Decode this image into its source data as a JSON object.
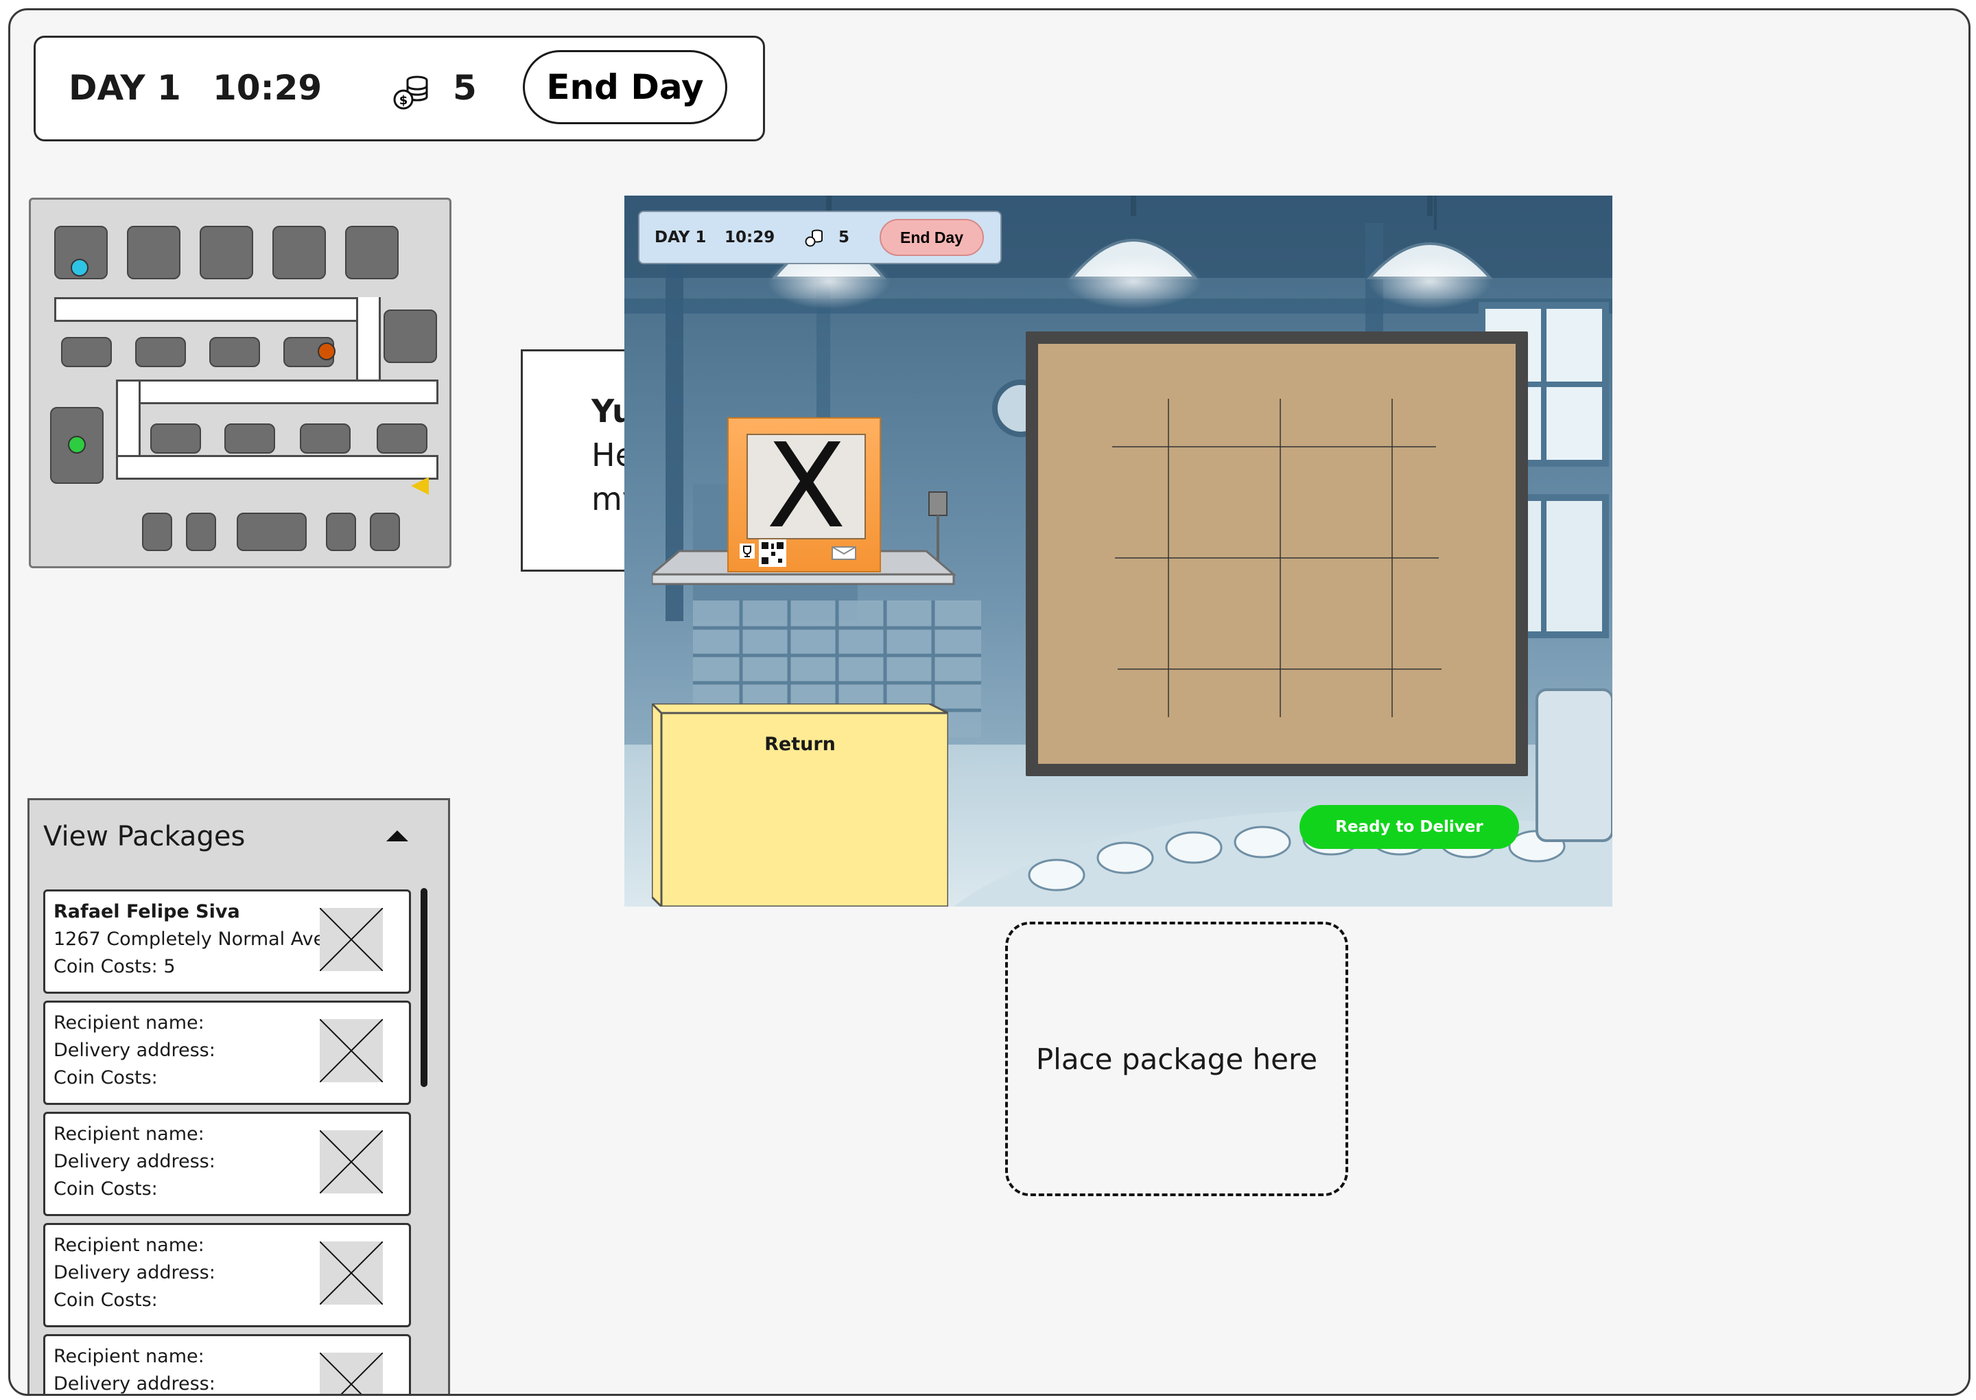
{
  "hud": {
    "day": "DAY 1",
    "time": "10:29",
    "coins": "5",
    "end_day": "End Day"
  },
  "scene_hud": {
    "day": "DAY 1",
    "time": "10:29",
    "coins": "5",
    "end_day": "End Day"
  },
  "dialogue": {
    "lines": [
      "Yu",
      "He",
      "my"
    ]
  },
  "packages": {
    "title": "View Packages",
    "cards": [
      {
        "name": "Rafael Felipe Siva",
        "address": "1267 Completely Normal Ave",
        "cost": "Coin Costs: 5"
      },
      {
        "name": "Recipient name:",
        "address": "Delivery address:",
        "cost": "Coin Costs:"
      },
      {
        "name": "Recipient name:",
        "address": "Delivery address:",
        "cost": "Coin Costs:"
      },
      {
        "name": "Recipient name:",
        "address": "Delivery address:",
        "cost": "Coin Costs:"
      },
      {
        "name": "Recipient name:",
        "address": "Delivery address:",
        "cost": ""
      }
    ]
  },
  "scene": {
    "package_mark": "X",
    "return_label": "Return",
    "ready_label": "Ready to Deliver"
  },
  "dropzone": {
    "label": "Place package here"
  },
  "colors": {
    "ready_green": "#12d31c",
    "end_day_pink": "#f4b6b4",
    "return_yellow": "#ffeb94",
    "board_tan": "#c4a77f",
    "package_orange": "#f59434",
    "player_marker": "#f1c40f",
    "map_dot_blue": "#2ec4e6",
    "map_dot_orange": "#d35400",
    "map_dot_green": "#2ecc40"
  }
}
